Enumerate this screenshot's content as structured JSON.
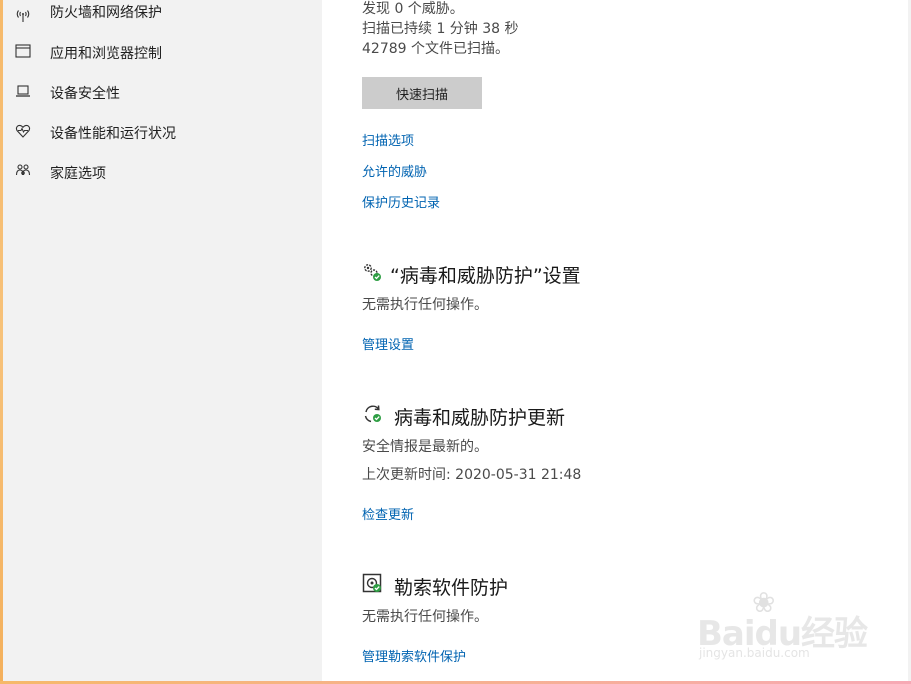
{
  "sidebar": {
    "items": [
      {
        "label": "防火墙和网络保护",
        "icon": "wifi-antenna-icon"
      },
      {
        "label": "应用和浏览器控制",
        "icon": "app-window-icon"
      },
      {
        "label": "设备安全性",
        "icon": "laptop-icon"
      },
      {
        "label": "设备性能和运行状况",
        "icon": "heart-pulse-icon"
      },
      {
        "label": "家庭选项",
        "icon": "family-icon"
      }
    ]
  },
  "scan": {
    "threats_line": "发现 0 个威胁。",
    "duration_line": "扫描已持续 1 分钟 38 秒",
    "files_line": "42789 个文件已扫描。",
    "quick_scan_button": "快速扫描",
    "links": [
      "扫描选项",
      "允许的威胁",
      "保护历史记录"
    ]
  },
  "settings_section": {
    "title": "“病毒和威胁防护”设置",
    "status": "无需执行任何操作。",
    "link": "管理设置"
  },
  "updates_section": {
    "title": "病毒和威胁防护更新",
    "status": "安全情报是最新的。",
    "last_update": "上次更新时间: 2020-05-31 21:48",
    "link": "检查更新"
  },
  "ransomware_section": {
    "title": "勒索软件防护",
    "status": "无需执行任何操作。",
    "link": "管理勒索软件保护"
  },
  "watermark": {
    "brand": "Baidu经验",
    "url": "jingyan.baidu.com"
  },
  "colors": {
    "link": "#0063b1",
    "sidebar_bg": "#f2f2f2",
    "ok_green": "#2f9e44"
  }
}
